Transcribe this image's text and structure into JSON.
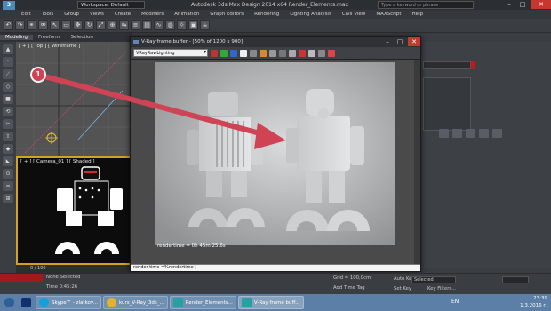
{
  "titlebar": {
    "workspace": "Workspace: Default",
    "title": "Autodesk 3ds Max Design 2014 x64    Render_Elements.max",
    "search_placeholder": "Type a keyword or phrase"
  },
  "menu": [
    "Edit",
    "Tools",
    "Group",
    "Views",
    "Create",
    "Modifiers",
    "Animation",
    "Graph Editors",
    "Rendering",
    "Lighting Analysis",
    "Civil View",
    "MAXScript",
    "Help"
  ],
  "ribbon": [
    "Modeling",
    "Freeform",
    "Selection"
  ],
  "viewports": {
    "top_label": "[ + ] [ Top ] [ Wireframe ]",
    "camera_label": "[ + ] [ Camera_01 ] [ Shaded ]"
  },
  "vfb": {
    "title": "V-Ray frame buffer - [50% of 1200 x 900]",
    "channel": "VRayRawLighting",
    "render_time": "rendertime = 0h 45m 25.6s |",
    "command": "render time =%rendertime |"
  },
  "annotation": {
    "badge": "1"
  },
  "timeline": {
    "frame": "0 / 100"
  },
  "status": {
    "selection": "None Selected",
    "time": "Time 0:45:26",
    "grid": "Grid = 100,0cm",
    "add_time_tag": "Add Time Tag",
    "auto_key": "Auto Key",
    "set_key": "Set Key",
    "selected": "Selected",
    "key_filters": "Key Filters..."
  },
  "taskbar": {
    "items": [
      "Skype™ - zlatkov...",
      "kurs_V-Ray_3ds_...",
      "Render_Elements...",
      "V-Ray frame buff..."
    ],
    "lang": "EN",
    "clock_time": "23:39",
    "clock_date": "1.3.2016 г."
  },
  "colors": {
    "annotation": "#d04355",
    "accent": "#d2a41c"
  }
}
